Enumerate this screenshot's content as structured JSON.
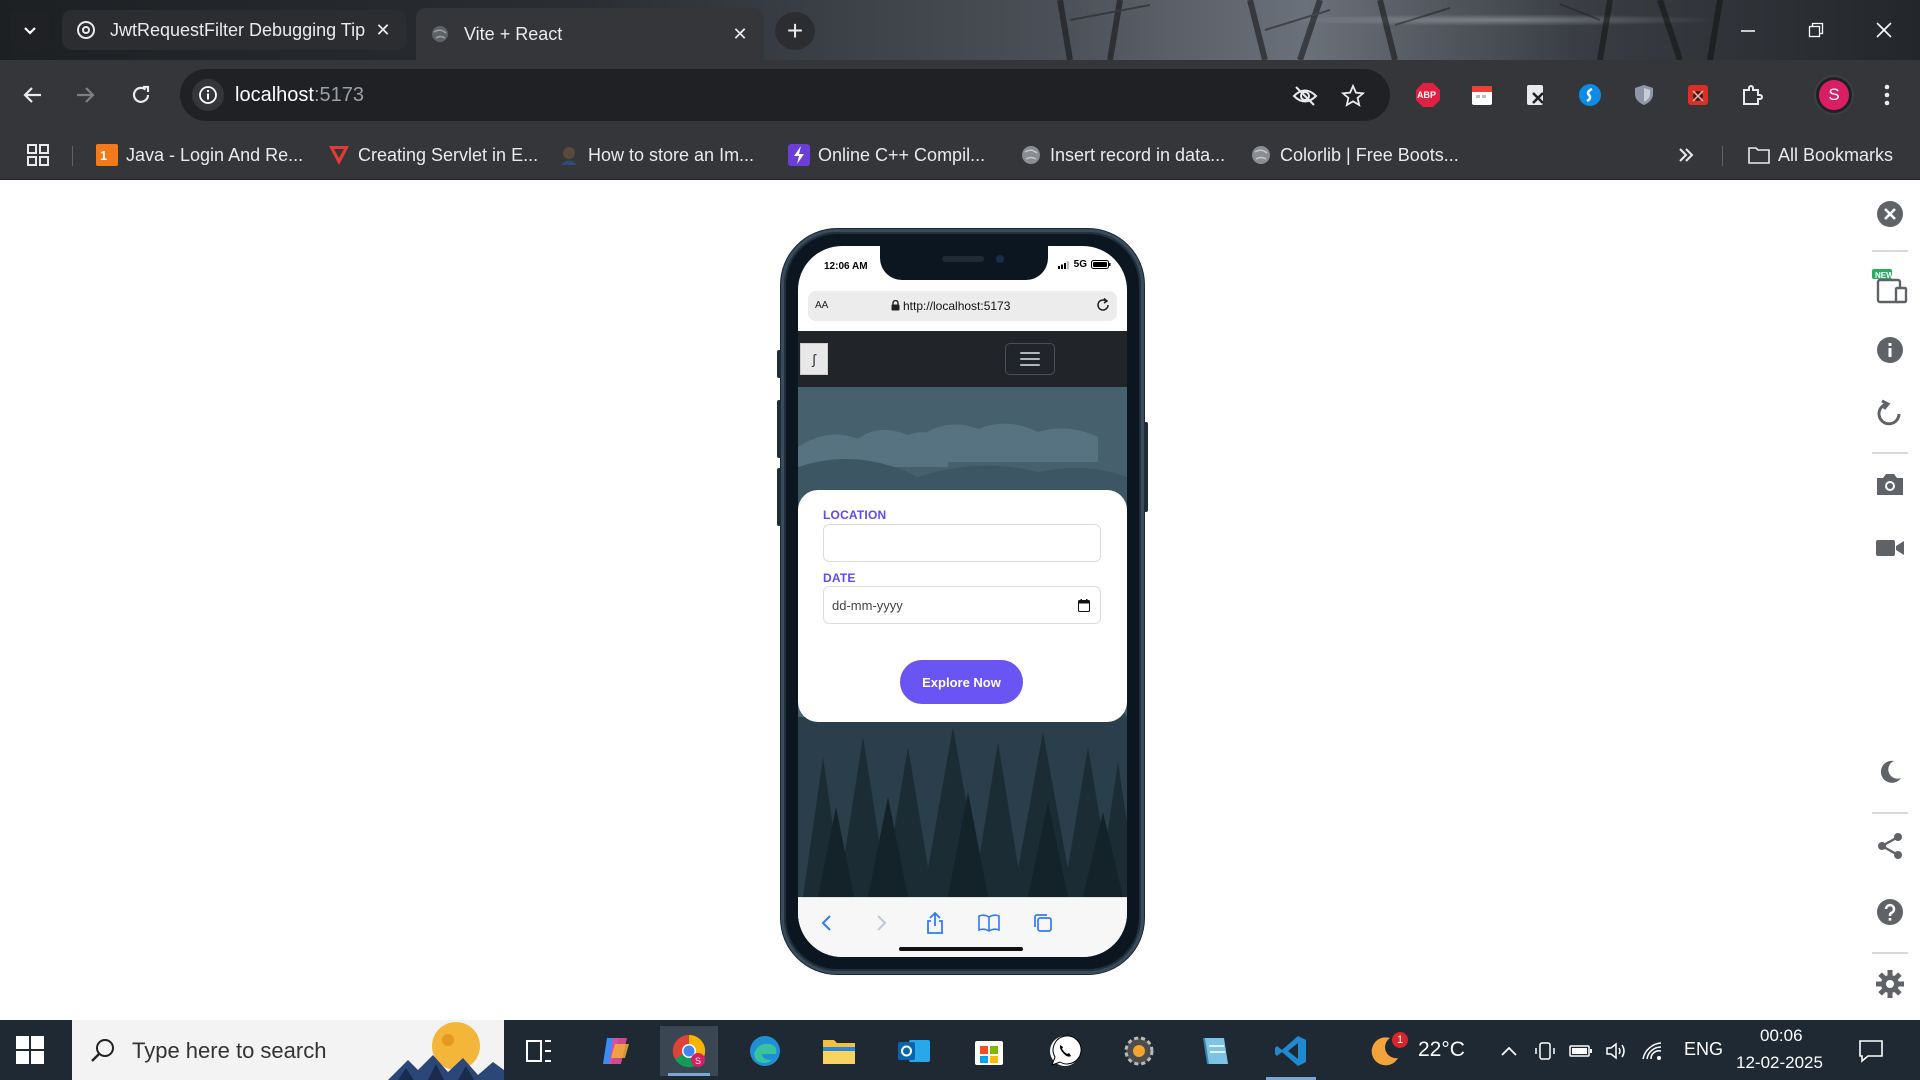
{
  "browser": {
    "tabs": [
      {
        "title": "JwtRequestFilter Debugging Tip",
        "icon": "openai-icon",
        "active": false
      },
      {
        "title": "Vite + React",
        "icon": "globe-icon",
        "active": true
      }
    ],
    "omnibox": {
      "host": "localhost",
      "port": ":5173"
    },
    "extensions": [
      "abp-icon",
      "calendar-ext-icon",
      "excel-ext-icon",
      "shazam-icon",
      "shield-ext-icon",
      "bug-ext-icon",
      "puzzle-icon"
    ],
    "profile_initial": "S",
    "extension_abp_label": "ABP"
  },
  "bookmarks": {
    "items": [
      {
        "label": "Java - Login And Re...",
        "icon": "bookmark-java-icon"
      },
      {
        "label": "Creating Servlet in E...",
        "icon": "bookmark-servlet-icon"
      },
      {
        "label": "How to store an Im...",
        "icon": "bookmark-img-icon"
      },
      {
        "label": "Online C++ Compil...",
        "icon": "bookmark-cpp-icon"
      },
      {
        "label": "Insert record in data...",
        "icon": "bookmark-globe-icon"
      },
      {
        "label": "Colorlib | Free Boots...",
        "icon": "bookmark-colorlib-icon"
      }
    ],
    "all_bookmarks_label": "All Bookmarks"
  },
  "emulator_panel": {
    "new_badge": "NEW"
  },
  "phone": {
    "status_time": "12:06 AM",
    "network": "5G",
    "safari_aa": "AA",
    "safari_url": "http://localhost:5173",
    "app": {
      "logo_glyph": "ʃ",
      "form": {
        "location_label": "LOCATION",
        "location_value": "",
        "date_label": "DATE",
        "date_placeholder": "dd-mm-yyyy",
        "submit_label": "Explore Now"
      }
    }
  },
  "taskbar": {
    "search_placeholder": "Type here to search",
    "weather": "22°C",
    "weather_badge": "1",
    "language": "ENG",
    "time": "00:06",
    "date": "12-02-2025"
  },
  "colors": {
    "accent": "#6a54f3",
    "hero": "#415c6b",
    "navbar": "#212529",
    "chrome_toolbar": "#35363a"
  }
}
